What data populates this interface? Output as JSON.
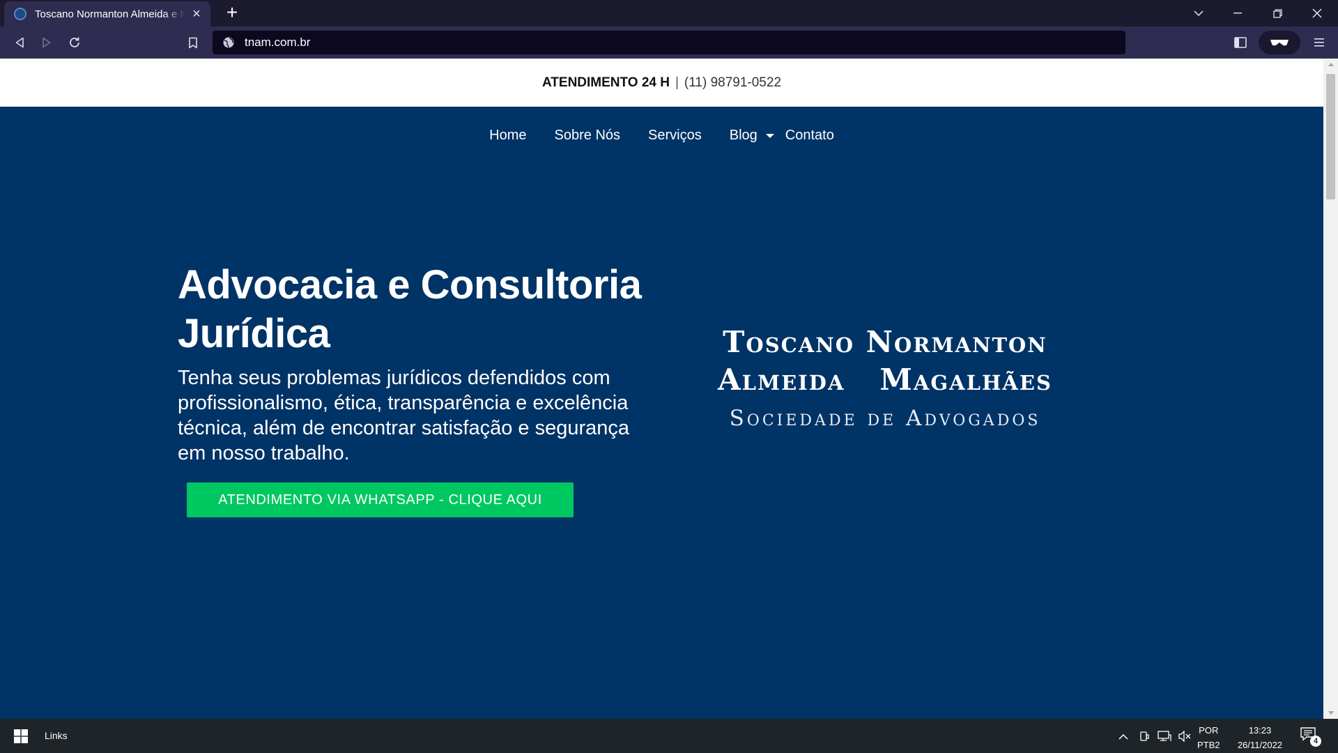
{
  "browser": {
    "tab_title": "Toscano Normanton Almeida e Magalhães",
    "url": "tnam.com.br"
  },
  "page": {
    "topbar": {
      "label": "ATENDIMENTO 24 H",
      "separator": "|",
      "phone": "(11) 98791-0522"
    },
    "nav": {
      "items": [
        {
          "label": "Home"
        },
        {
          "label": "Sobre Nós"
        },
        {
          "label": "Serviços"
        },
        {
          "label": "Blog"
        },
        {
          "label": "Contato"
        }
      ]
    },
    "hero": {
      "title": "Advocacia e Consultoria Jurídica",
      "subtitle": "Tenha seus problemas jurídicos defendidos com profissionalismo, ética, transparência e excelência técnica, além de encontrar satisfação e segurança em nosso trabalho.",
      "cta": "ATENDIMENTO VIA WHATSAPP - CLIQUE AQUI"
    },
    "logo": {
      "line1": "Toscano Normanton",
      "line2": "Almeida   Magalhães",
      "line3": "Sociedade de Advogados"
    }
  },
  "taskbar": {
    "links_label": "Links",
    "lang_top": "POR",
    "lang_bottom": "PTB2",
    "time": "13:23",
    "date": "26/11/2022",
    "notification_count": "4"
  },
  "colors": {
    "page_bg": "#003366",
    "cta_green": "#00c860",
    "chrome_dark": "#1c1a2e",
    "chrome_toolbar": "#2e2c50"
  }
}
